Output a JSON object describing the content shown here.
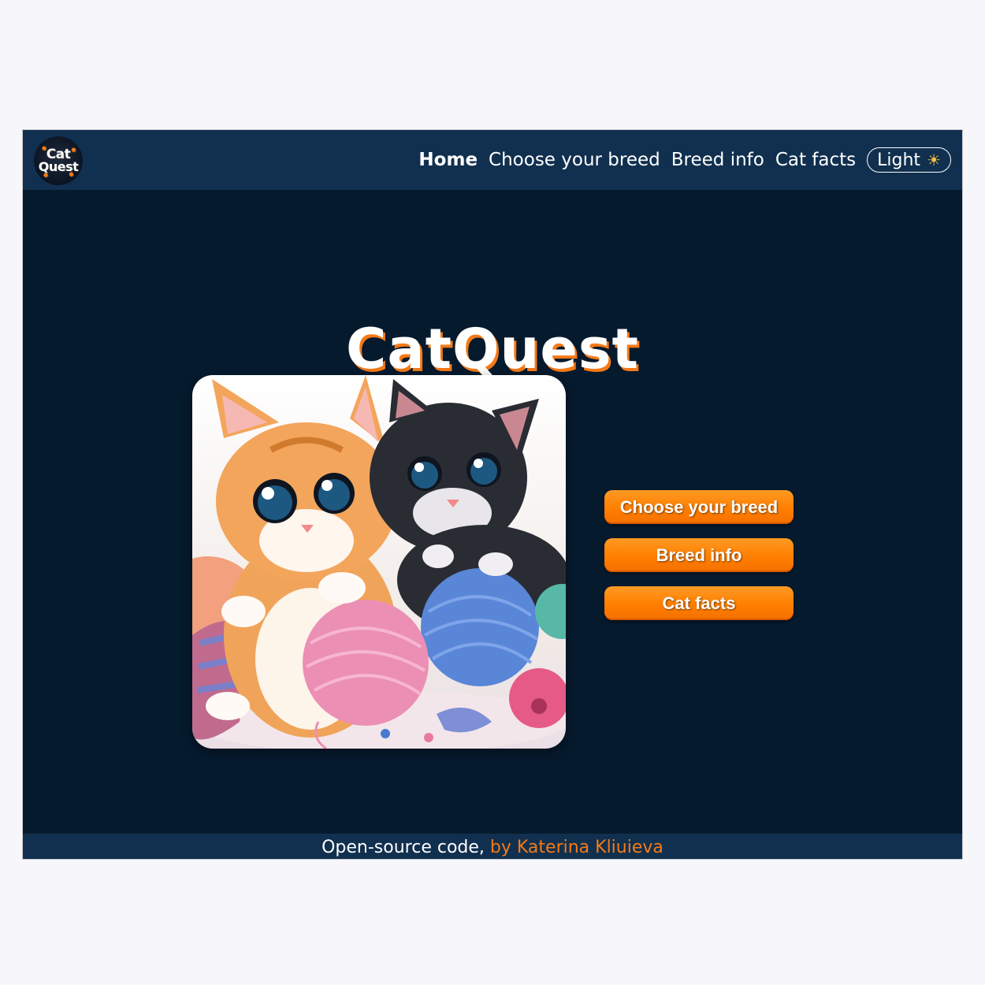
{
  "logo": {
    "line1": "Cat",
    "line2": "Quest"
  },
  "nav": {
    "items": [
      {
        "label": "Home",
        "active": true
      },
      {
        "label": "Choose your breed",
        "active": false
      },
      {
        "label": "Breed info",
        "active": false
      },
      {
        "label": "Cat facts",
        "active": false
      }
    ],
    "theme_toggle": {
      "label": "Light",
      "icon": "sun-icon"
    }
  },
  "hero": {
    "title": "CatQuest",
    "image_alt": "Two kittens playing with balls of yarn"
  },
  "buttons": [
    {
      "label": "Choose your breed"
    },
    {
      "label": "Breed info"
    },
    {
      "label": "Cat facts"
    }
  ],
  "footer": {
    "text": "Open-source code,",
    "author_link": "by Katerina Kliuieva"
  },
  "colors": {
    "background": "#061a2e",
    "header": "#11304f",
    "accent": "#ff7f00",
    "page": "#f6f6fb"
  }
}
